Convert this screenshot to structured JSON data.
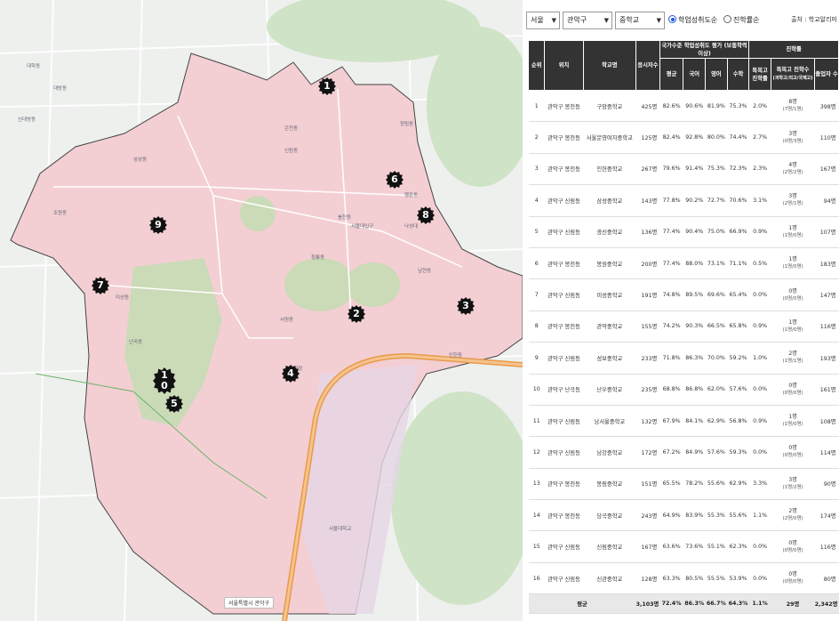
{
  "map": {
    "labels": [
      "대학동",
      "신림동",
      "봉천동",
      "서원동",
      "청룡동",
      "은천동",
      "인헌동",
      "남현동",
      "낙성대",
      "서울대입구",
      "관악구청",
      "서울대학교",
      "신대방동",
      "대방동",
      "조원동",
      "미성동",
      "난곡동",
      "삼성동",
      "행운동",
      "청림동"
    ],
    "markers": [
      "1",
      "2",
      "3",
      "4",
      "5",
      "6",
      "7",
      "8",
      "9",
      "10"
    ],
    "footer": "서울특별시 관악구"
  },
  "filters": {
    "city": "서울",
    "district": "관악구",
    "level": "중학교",
    "sort_achievement": "학업성취도순",
    "sort_transfer": "진학률순",
    "source": "출처 : 학교알리미"
  },
  "table": {
    "headers": {
      "rank": "순위",
      "location": "위치",
      "school": "학교명",
      "examinees": "응시자수",
      "achievement_group": "국가수준 학업성취도 평가 (보통학력이상)",
      "avg": "평균",
      "korean": "국어",
      "english": "영어",
      "math": "수학",
      "progress_group": "진학률",
      "special_rate": "특목고 진학률",
      "special_count": "특목고 진학수",
      "special_count_sub": "(과학고/외고/국제고)",
      "graduates": "졸업자 수"
    },
    "rows": [
      {
        "rank": "1",
        "loc": "관악구 봉천동",
        "school": "구암중학교",
        "n": "425명",
        "avg": "82.6%",
        "kor": "90.6%",
        "eng": "81.9%",
        "math": "75.3%",
        "rate": "2.0%",
        "cnt": "8명",
        "cnt_sub": "(7명/1명)",
        "grad": "398명"
      },
      {
        "rank": "2",
        "loc": "관악구 봉천동",
        "school": "서울문영여자중학교",
        "n": "125명",
        "avg": "82.4%",
        "kor": "92.8%",
        "eng": "80.0%",
        "math": "74.4%",
        "rate": "2.7%",
        "cnt": "3명",
        "cnt_sub": "(0명/3명)",
        "grad": "110명"
      },
      {
        "rank": "3",
        "loc": "관악구 봉천동",
        "school": "인헌중학교",
        "n": "267명",
        "avg": "79.6%",
        "kor": "91.4%",
        "eng": "75.3%",
        "math": "72.3%",
        "rate": "2.3%",
        "cnt": "4명",
        "cnt_sub": "(2명/2명)",
        "grad": "167명"
      },
      {
        "rank": "4",
        "loc": "관악구 신림동",
        "school": "삼성중학교",
        "n": "143명",
        "avg": "77.8%",
        "kor": "90.2%",
        "eng": "72.7%",
        "math": "70.6%",
        "rate": "3.1%",
        "cnt": "3명",
        "cnt_sub": "(2명/1명)",
        "grad": "94명"
      },
      {
        "rank": "5",
        "loc": "관악구 신림동",
        "school": "광신중학교",
        "n": "136명",
        "avg": "77.4%",
        "kor": "90.4%",
        "eng": "75.0%",
        "math": "66.9%",
        "rate": "0.9%",
        "cnt": "1명",
        "cnt_sub": "(1명/0명)",
        "grad": "107명"
      },
      {
        "rank": "6",
        "loc": "관악구 봉천동",
        "school": "봉원중학교",
        "n": "200명",
        "avg": "77.4%",
        "kor": "88.0%",
        "eng": "73.1%",
        "math": "71.1%",
        "rate": "0.5%",
        "cnt": "1명",
        "cnt_sub": "(1명/0명)",
        "grad": "183명"
      },
      {
        "rank": "7",
        "loc": "관악구 신림동",
        "school": "미성중학교",
        "n": "191명",
        "avg": "74.8%",
        "kor": "89.5%",
        "eng": "69.6%",
        "math": "65.4%",
        "rate": "0.0%",
        "cnt": "0명",
        "cnt_sub": "(0명/0명)",
        "grad": "147명"
      },
      {
        "rank": "8",
        "loc": "관악구 봉천동",
        "school": "관악중학교",
        "n": "155명",
        "avg": "74.2%",
        "kor": "90.3%",
        "eng": "66.5%",
        "math": "65.8%",
        "rate": "0.9%",
        "cnt": "1명",
        "cnt_sub": "(1명/0명)",
        "grad": "116명"
      },
      {
        "rank": "9",
        "loc": "관악구 신림동",
        "school": "성보중학교",
        "n": "233명",
        "avg": "71.8%",
        "kor": "86.3%",
        "eng": "70.0%",
        "math": "59.2%",
        "rate": "1.0%",
        "cnt": "2명",
        "cnt_sub": "(1명/1명)",
        "grad": "193명"
      },
      {
        "rank": "10",
        "loc": "관악구 난곡동",
        "school": "난우중학교",
        "n": "235명",
        "avg": "68.8%",
        "kor": "86.8%",
        "eng": "62.0%",
        "math": "57.6%",
        "rate": "0.0%",
        "cnt": "0명",
        "cnt_sub": "(0명/0명)",
        "grad": "161명"
      },
      {
        "rank": "11",
        "loc": "관악구 신림동",
        "school": "남서울중학교",
        "n": "132명",
        "avg": "67.9%",
        "kor": "84.1%",
        "eng": "62.9%",
        "math": "56.8%",
        "rate": "0.9%",
        "cnt": "1명",
        "cnt_sub": "(1명/0명)",
        "grad": "108명"
      },
      {
        "rank": "12",
        "loc": "관악구 신림동",
        "school": "남강중학교",
        "n": "172명",
        "avg": "67.2%",
        "kor": "84.9%",
        "eng": "57.6%",
        "math": "59.3%",
        "rate": "0.0%",
        "cnt": "0명",
        "cnt_sub": "(0명/0명)",
        "grad": "114명"
      },
      {
        "rank": "13",
        "loc": "관악구 봉천동",
        "school": "봉림중학교",
        "n": "151명",
        "avg": "65.5%",
        "kor": "78.2%",
        "eng": "55.6%",
        "math": "62.9%",
        "rate": "3.3%",
        "cnt": "3명",
        "cnt_sub": "(1명/2명)",
        "grad": "90명"
      },
      {
        "rank": "14",
        "loc": "관악구 봉천동",
        "school": "당곡중학교",
        "n": "243명",
        "avg": "64.9%",
        "kor": "83.9%",
        "eng": "55.3%",
        "math": "55.6%",
        "rate": "1.1%",
        "cnt": "2명",
        "cnt_sub": "(2명/0명)",
        "grad": "174명"
      },
      {
        "rank": "15",
        "loc": "관악구 신림동",
        "school": "신림중학교",
        "n": "167명",
        "avg": "63.6%",
        "kor": "73.6%",
        "eng": "55.1%",
        "math": "62.3%",
        "rate": "0.0%",
        "cnt": "0명",
        "cnt_sub": "(0명/0명)",
        "grad": "116명"
      },
      {
        "rank": "16",
        "loc": "관악구 신림동",
        "school": "신관중학교",
        "n": "128명",
        "avg": "63.3%",
        "kor": "80.5%",
        "eng": "55.5%",
        "math": "53.9%",
        "rate": "0.0%",
        "cnt": "0명",
        "cnt_sub": "(0명/0명)",
        "grad": "80명"
      }
    ],
    "average": {
      "label": "평균",
      "n": "3,103명",
      "avg": "72.4%",
      "kor": "86.3%",
      "eng": "66.7%",
      "math": "64.3%",
      "rate": "1.1%",
      "cnt": "29명",
      "grad": "2,342명"
    }
  },
  "colors": {
    "district_fill": "#f3cfd3",
    "header_bg": "#333333",
    "radio_on": "#1e5bd6",
    "highway": "#e89a4c"
  }
}
